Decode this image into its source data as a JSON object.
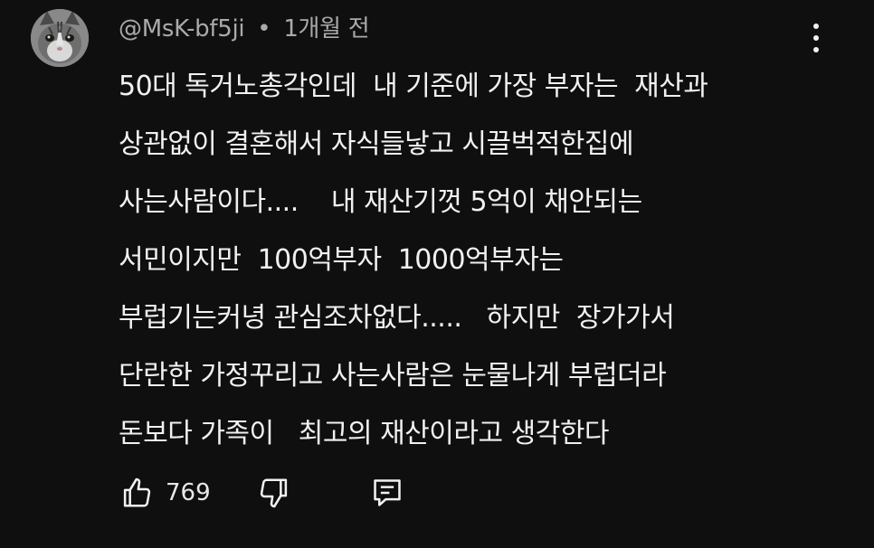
{
  "comment": {
    "author": "@MsK-bf5ji",
    "separator": "•",
    "time": "1개월 전",
    "lines": [
      "50대 독거노총각인데  내 기준에 가장 부자는  재산과",
      "상관없이 결혼해서 자식들낳고 시끌벅적한집에",
      "사는사람이다....    내 재산기껏 5억이 채안되는",
      "서민이지만  100억부자  1000억부자는",
      "부럽기는커녕 관심조차없다.....   하지만  장가가서",
      "단란한 가정꾸리고 사는사람은 눈물나게 부럽더라",
      "돈보다 가족이   최고의 재산이라고 생각한다"
    ]
  },
  "actions": {
    "like_count": "769",
    "like_icon": "thumb-up-icon",
    "dislike_icon": "thumb-down-icon",
    "reply_icon": "comment-icon",
    "menu_icon": "more-vert-icon"
  },
  "colors": {
    "background": "#0f0f0f",
    "text": "#f1f1f1",
    "meta_text": "#aaaaaa"
  }
}
